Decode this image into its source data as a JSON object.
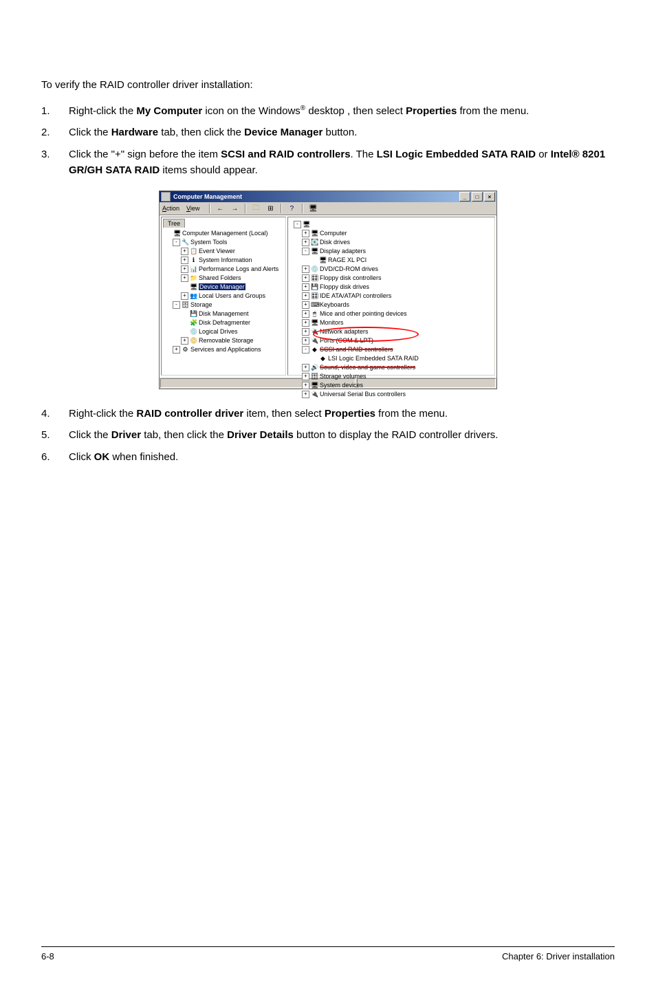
{
  "intro": "To verify the RAID controller driver installation:",
  "steps1": [
    {
      "n": "1.",
      "pre": "Right-click the ",
      "b1": "My Computer",
      "mid": " icon on the Windows",
      "sup": "®",
      "post": " desktop , then select ",
      "b2": "Properties",
      "tail": " from the menu."
    },
    {
      "n": "2.",
      "pre": "Click the ",
      "b1": "Hardware",
      "mid": " tab, then click the ",
      "b2": "Device Manager",
      "post": " button."
    },
    {
      "n": "3.",
      "pre": "Click the \"+\" sign before the item ",
      "b1": "SCSI and RAID controllers",
      "mid": ". The ",
      "b2": "LSI Logic Embedded SATA RAID",
      "mid2": " or ",
      "b3": "Intel®  8201 GR/GH SATA RAID",
      "post": " items should appear."
    }
  ],
  "steps2": [
    {
      "n": "4.",
      "pre": "Right-click the ",
      "b1": "RAID controller driver",
      "mid": " item, then select ",
      "b2": "Properties",
      "post": " from the menu."
    },
    {
      "n": "5.",
      "pre": "Click the ",
      "b1": "Driver",
      "mid": " tab, then click the ",
      "b2": "Driver Details",
      "post": " button to display the RAID controller drivers."
    },
    {
      "n": "6.",
      "pre": "Click ",
      "b1": "OK",
      "post": " when finished."
    }
  ],
  "mmc": {
    "title": "Computer Management",
    "menu_action": "Action",
    "menu_view": "View",
    "tree_tab": "Tree",
    "left_tree": [
      {
        "lvl": 0,
        "exp": "",
        "ico": "🖥",
        "label": "Computer Management (Local)"
      },
      {
        "lvl": 1,
        "exp": "-",
        "ico": "🔧",
        "label": "System Tools"
      },
      {
        "lvl": 2,
        "exp": "+",
        "ico": "📋",
        "label": "Event Viewer"
      },
      {
        "lvl": 2,
        "exp": "+",
        "ico": "ℹ",
        "label": "System Information"
      },
      {
        "lvl": 2,
        "exp": "+",
        "ico": "📊",
        "label": "Performance Logs and Alerts"
      },
      {
        "lvl": 2,
        "exp": "+",
        "ico": "📁",
        "label": "Shared Folders"
      },
      {
        "lvl": 2,
        "exp": "",
        "ico": "🖥",
        "label": "Device Manager",
        "sel": true
      },
      {
        "lvl": 2,
        "exp": "+",
        "ico": "👥",
        "label": "Local Users and Groups"
      },
      {
        "lvl": 1,
        "exp": "-",
        "ico": "🗄",
        "label": "Storage"
      },
      {
        "lvl": 2,
        "exp": "",
        "ico": "💾",
        "label": "Disk Management"
      },
      {
        "lvl": 2,
        "exp": "",
        "ico": "🧩",
        "label": "Disk Defragmenter"
      },
      {
        "lvl": 2,
        "exp": "",
        "ico": "💿",
        "label": "Logical Drives"
      },
      {
        "lvl": 2,
        "exp": "+",
        "ico": "📀",
        "label": "Removable Storage"
      },
      {
        "lvl": 1,
        "exp": "+",
        "ico": "⚙",
        "label": "Services and Applications"
      }
    ],
    "right_tree": [
      {
        "lvl": 0,
        "exp": "-",
        "ico": "🖥",
        "label": ""
      },
      {
        "lvl": 1,
        "exp": "+",
        "ico": "🖥",
        "label": "Computer"
      },
      {
        "lvl": 1,
        "exp": "+",
        "ico": "💽",
        "label": "Disk drives"
      },
      {
        "lvl": 1,
        "exp": "-",
        "ico": "🖥",
        "label": "Display adapters"
      },
      {
        "lvl": 2,
        "exp": "",
        "ico": "🖥",
        "label": "RAGE XL   PCI"
      },
      {
        "lvl": 1,
        "exp": "+",
        "ico": "💿",
        "label": "DVD/CD-ROM drives"
      },
      {
        "lvl": 1,
        "exp": "+",
        "ico": "🎛",
        "label": "Floppy disk controllers"
      },
      {
        "lvl": 1,
        "exp": "+",
        "ico": "💾",
        "label": "Floppy disk drives"
      },
      {
        "lvl": 1,
        "exp": "+",
        "ico": "🎛",
        "label": "IDE ATA/ATAPI controllers"
      },
      {
        "lvl": 1,
        "exp": "+",
        "ico": "⌨",
        "label": "Keyboards"
      },
      {
        "lvl": 1,
        "exp": "+",
        "ico": "🖱",
        "label": "Mice and other pointing devices"
      },
      {
        "lvl": 1,
        "exp": "+",
        "ico": "🖥",
        "label": "Monitors"
      },
      {
        "lvl": 1,
        "exp": "+",
        "ico": "🔌",
        "label": "Network adapters"
      },
      {
        "lvl": 1,
        "exp": "+",
        "ico": "🔌",
        "label": "Ports (COM & LPT)"
      },
      {
        "lvl": 1,
        "exp": "-",
        "ico": "◆",
        "label": "SCSI and RAID controllers",
        "strike": true
      },
      {
        "lvl": 2,
        "exp": "",
        "ico": "◆",
        "label": "LSI Logic Embedded SATA RAID"
      },
      {
        "lvl": 1,
        "exp": "+",
        "ico": "🔊",
        "label": "Sound, video and game controllers",
        "strike": true
      },
      {
        "lvl": 1,
        "exp": "+",
        "ico": "🗄",
        "label": "Storage volumes"
      },
      {
        "lvl": 1,
        "exp": "+",
        "ico": "🖥",
        "label": "System devices"
      },
      {
        "lvl": 1,
        "exp": "+",
        "ico": "🔌",
        "label": "Universal Serial Bus controllers"
      }
    ]
  },
  "footer_left": "6-8",
  "footer_right": "Chapter 6: Driver installation"
}
